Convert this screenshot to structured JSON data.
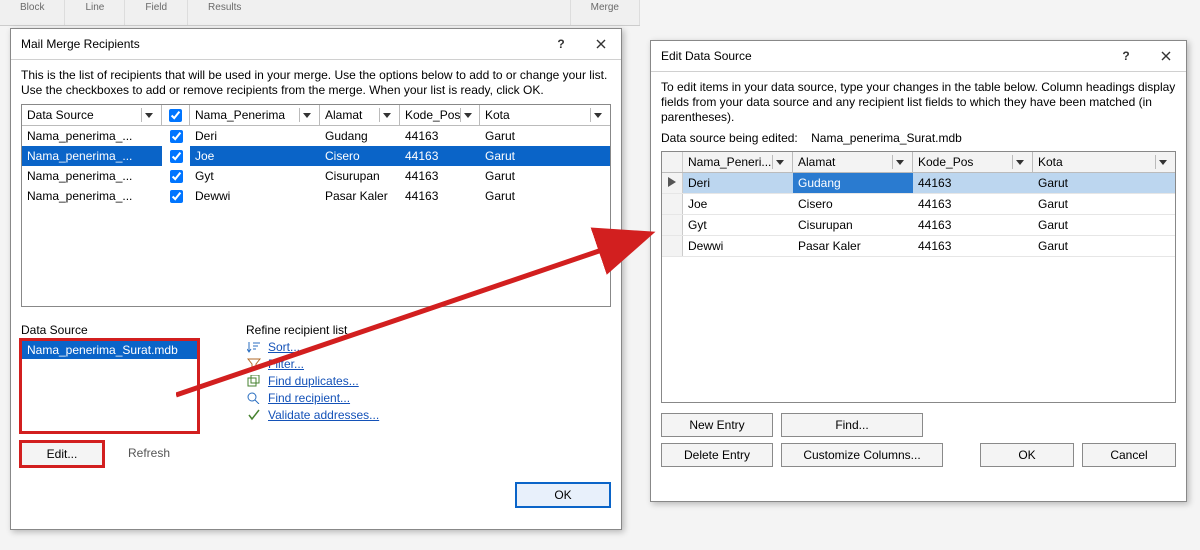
{
  "ribbon": {
    "items": [
      "Block",
      "Line",
      "Field",
      "Results",
      "Merge"
    ]
  },
  "dlg1": {
    "title": "Mail Merge Recipients",
    "instr": "This is the list of recipients that will be used in your merge.  Use the options below to add to or change your list. Use the checkboxes to add or remove recipients from the merge.  When your list is ready, click OK.",
    "cols": [
      "Data Source",
      "",
      "Nama_Penerima",
      "Alamat",
      "Kode_Pos",
      "Kota"
    ],
    "rows": [
      {
        "ds": "Nama_penerima_...",
        "chk": true,
        "n": "Deri",
        "a": "Gudang",
        "k": "44163",
        "kt": "Garut",
        "sel": false
      },
      {
        "ds": "Nama_penerima_...",
        "chk": true,
        "n": "Joe",
        "a": "Cisero",
        "k": "44163",
        "kt": "Garut",
        "sel": true
      },
      {
        "ds": "Nama_penerima_...",
        "chk": true,
        "n": "Gyt",
        "a": "Cisurupan",
        "k": "44163",
        "kt": "Garut",
        "sel": false
      },
      {
        "ds": "Nama_penerima_...",
        "chk": true,
        "n": "Dewwi",
        "a": "Pasar Kaler",
        "k": "44163",
        "kt": "Garut",
        "sel": false
      }
    ],
    "ds_label": "Data Source",
    "ds_item": "Nama_penerima_Surat.mdb",
    "refine_label": "Refine recipient list",
    "links": {
      "sort": "Sort...",
      "filter": "Filter...",
      "dup": "Find duplicates...",
      "find": "Find recipient...",
      "val": "Validate addresses..."
    },
    "edit_btn": "Edit...",
    "refresh_btn": "Refresh",
    "ok_btn": "OK"
  },
  "dlg2": {
    "title": "Edit Data Source",
    "instr": "To edit items in your data source, type your changes in the table below. Column headings display fields from your data source and any recipient list fields to which they have been matched (in parentheses).",
    "ds_label": "Data source being edited:",
    "ds_name": "Nama_penerima_Surat.mdb",
    "cols": [
      "Nama_Peneri...",
      "Alamat",
      "Kode_Pos",
      "Kota"
    ],
    "rows": [
      {
        "n": "Deri",
        "a": "Gudang",
        "k": "44163",
        "kt": "Garut",
        "sel": true
      },
      {
        "n": "Joe",
        "a": "Cisero",
        "k": "44163",
        "kt": "Garut",
        "sel": false
      },
      {
        "n": "Gyt",
        "a": "Cisurupan",
        "k": "44163",
        "kt": "Garut",
        "sel": false
      },
      {
        "n": "Dewwi",
        "a": "Pasar Kaler",
        "k": "44163",
        "kt": "Garut",
        "sel": false
      }
    ],
    "new_entry": "New Entry",
    "find": "Find...",
    "delete_entry": "Delete Entry",
    "customize": "Customize Columns...",
    "ok": "OK",
    "cancel": "Cancel"
  }
}
